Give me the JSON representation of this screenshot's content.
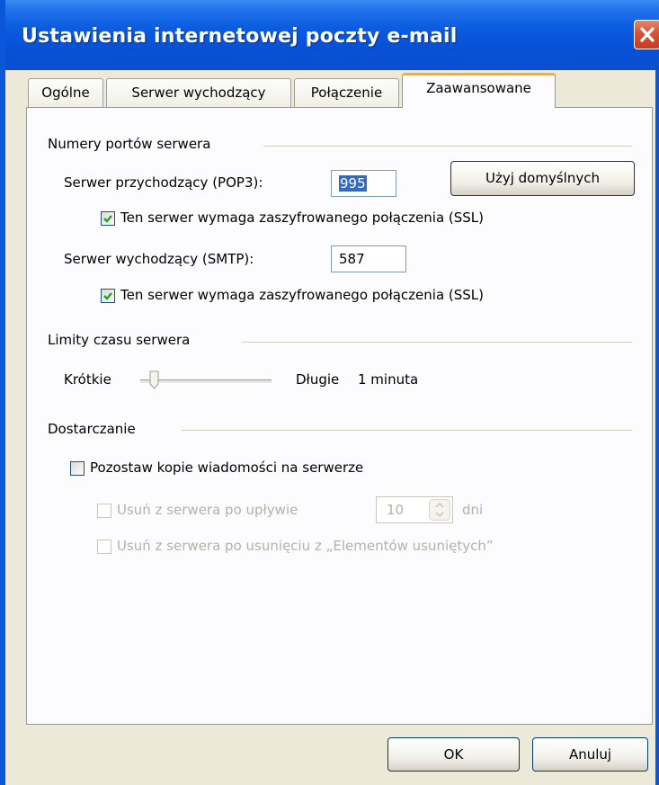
{
  "window": {
    "title": "Ustawienia internetowej poczty e-mail"
  },
  "tabs": [
    {
      "label": "Ogólne"
    },
    {
      "label": "Serwer wychodzący"
    },
    {
      "label": "Połączenie"
    },
    {
      "label": "Zaawansowane",
      "active": true
    }
  ],
  "ports": {
    "group_label": "Numery portów serwera",
    "incoming_label": "Serwer przychodzący (POP3):",
    "incoming_value": "995",
    "default_button": "Użyj domyślnych",
    "incoming_ssl_label": "Ten serwer wymaga zaszyfrowanego połączenia (SSL)",
    "incoming_ssl_checked": true,
    "outgoing_label": "Serwer wychodzący (SMTP):",
    "outgoing_value": "587",
    "outgoing_ssl_label": "Ten serwer wymaga zaszyfrowanego połączenia (SSL)",
    "outgoing_ssl_checked": true
  },
  "timeout": {
    "group_label": "Limity czasu serwera",
    "short_label": "Krótkie",
    "long_label": "Długie",
    "value_text": "1 minuta",
    "slider_level": 0.1
  },
  "delivery": {
    "group_label": "Dostarczanie",
    "leave_copy_label": "Pozostaw kopie wiadomości na serwerze",
    "leave_copy_checked": false,
    "remove_after_label": "Usuń z serwera po upływie",
    "remove_after_value": "10",
    "days_label": "dni",
    "remove_deleted_label": "Usuń z serwera po usunięciu z „Elementów usuniętych”"
  },
  "footer": {
    "ok": "OK",
    "cancel": "Anuluj"
  },
  "icons": {
    "close": "close-icon",
    "check": "checkmark-icon",
    "spin": "spin-arrows-icon"
  },
  "colors": {
    "titlebar": "#0a5ce0",
    "check": "#21a121",
    "active_tab_accent": "#f6b128"
  }
}
